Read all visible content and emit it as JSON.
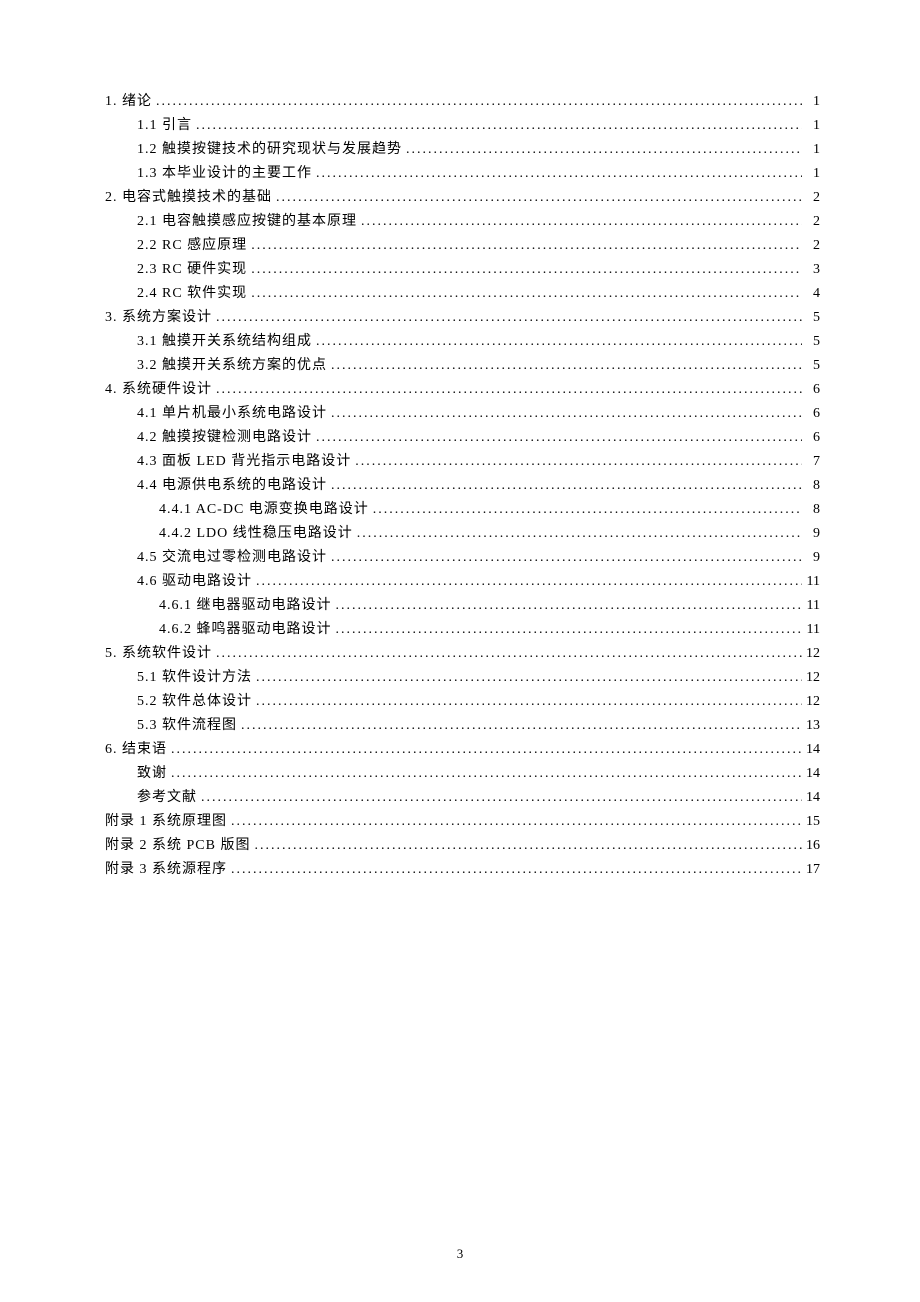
{
  "page_number": "3",
  "toc": [
    {
      "level": 0,
      "label": "1. 绪论",
      "page": "1"
    },
    {
      "level": 1,
      "label": "1.1 引言",
      "page": "1"
    },
    {
      "level": 1,
      "label": "1.2 触摸按键技术的研究现状与发展趋势",
      "page": "1"
    },
    {
      "level": 1,
      "label": "1.3 本毕业设计的主要工作",
      "page": "1"
    },
    {
      "level": 0,
      "label": "2. 电容式触摸技术的基础",
      "page": "2"
    },
    {
      "level": 1,
      "label": "2.1 电容触摸感应按键的基本原理",
      "page": "2"
    },
    {
      "level": 1,
      "label": "2.2 RC 感应原理",
      "page": "2"
    },
    {
      "level": 1,
      "label": "2.3 RC 硬件实现",
      "page": "3"
    },
    {
      "level": 1,
      "label": "2.4 RC 软件实现",
      "page": "4"
    },
    {
      "level": 0,
      "label": "3. 系统方案设计",
      "page": "5"
    },
    {
      "level": 1,
      "label": "3.1 触摸开关系统结构组成",
      "page": "5"
    },
    {
      "level": 1,
      "label": "3.2 触摸开关系统方案的优点",
      "page": "5"
    },
    {
      "level": 0,
      "label": "4. 系统硬件设计",
      "page": "6"
    },
    {
      "level": 1,
      "label": "4.1 单片机最小系统电路设计",
      "page": "6"
    },
    {
      "level": 1,
      "label": "4.2 触摸按键检测电路设计",
      "page": "6"
    },
    {
      "level": 1,
      "label": "4.3 面板 LED 背光指示电路设计",
      "page": "7"
    },
    {
      "level": 1,
      "label": "4.4 电源供电系统的电路设计",
      "page": "8"
    },
    {
      "level": 2,
      "label": "4.4.1 AC-DC 电源变换电路设计",
      "page": "8"
    },
    {
      "level": 2,
      "label": "4.4.2 LDO 线性稳压电路设计",
      "page": "9"
    },
    {
      "level": 1,
      "label": "4.5 交流电过零检测电路设计",
      "page": "9"
    },
    {
      "level": 1,
      "label": "4.6 驱动电路设计",
      "page": "11"
    },
    {
      "level": 2,
      "label": "4.6.1 继电器驱动电路设计",
      "page": "11"
    },
    {
      "level": 2,
      "label": "4.6.2 蜂鸣器驱动电路设计",
      "page": "11"
    },
    {
      "level": 0,
      "label": "5. 系统软件设计",
      "page": "12"
    },
    {
      "level": 1,
      "label": "5.1 软件设计方法",
      "page": "12"
    },
    {
      "level": 1,
      "label": "5.2 软件总体设计",
      "page": "12"
    },
    {
      "level": 1,
      "label": "5.3 软件流程图",
      "page": "13"
    },
    {
      "level": 0,
      "label": "6. 结束语",
      "page": "14"
    },
    {
      "level": 1,
      "label": "致谢",
      "page": "14"
    },
    {
      "level": 1,
      "label": "参考文献",
      "page": "14"
    },
    {
      "level": 0,
      "label": "附录 1 系统原理图",
      "page": "15"
    },
    {
      "level": 0,
      "label": "附录 2 系统 PCB 版图",
      "page": "16"
    },
    {
      "level": 0,
      "label": "附录 3 系统源程序",
      "page": "17"
    }
  ]
}
